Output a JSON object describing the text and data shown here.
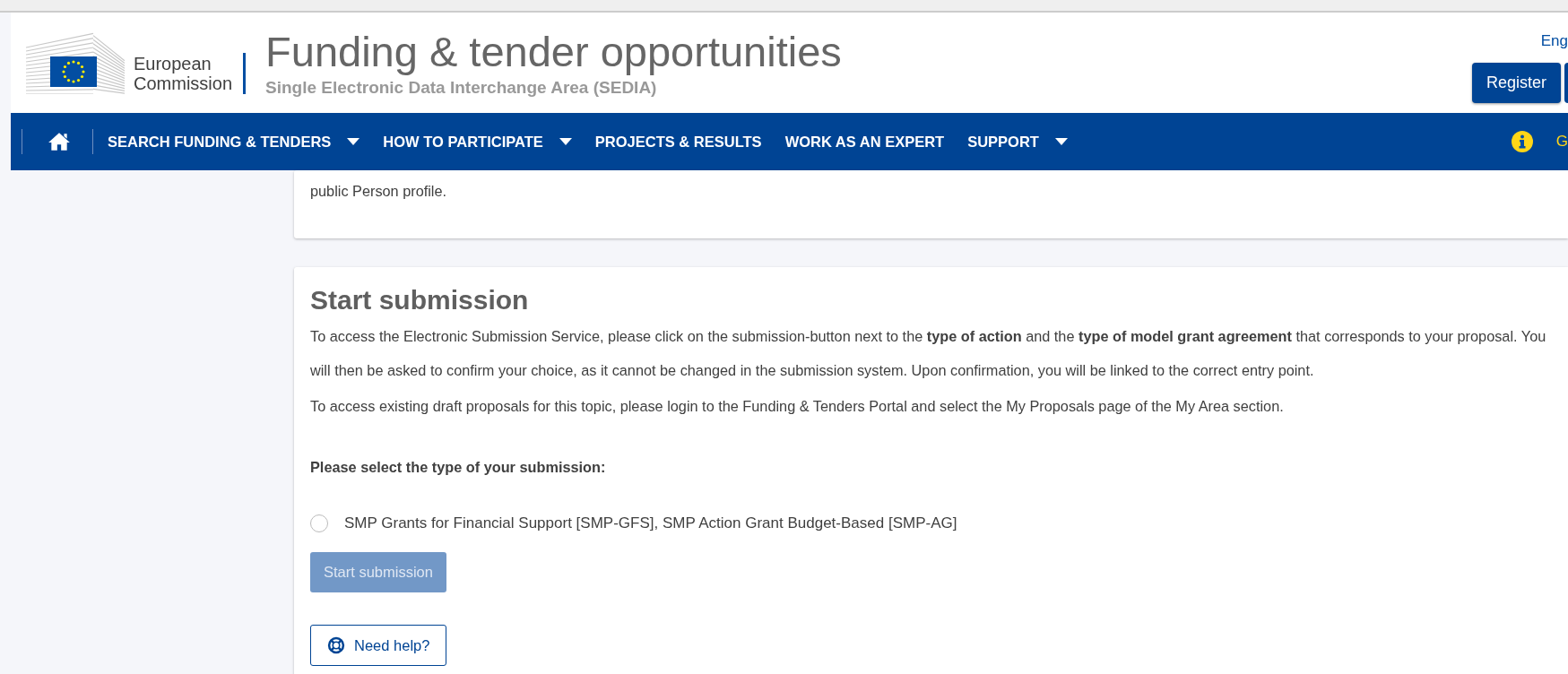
{
  "header": {
    "logo_text": [
      "European",
      "Commission"
    ],
    "title": "Funding & tender opportunities",
    "subtitle": "Single Electronic Data Interchange Area (SEDIA)",
    "language": "Eng",
    "register_button": "Register"
  },
  "nav": {
    "items": [
      {
        "label": "SEARCH FUNDING & TENDERS",
        "dropdown": true
      },
      {
        "label": "HOW TO PARTICIPATE",
        "dropdown": true
      },
      {
        "label": "PROJECTS & RESULTS",
        "dropdown": false
      },
      {
        "label": "WORK AS AN EXPERT",
        "dropdown": false
      },
      {
        "label": "SUPPORT",
        "dropdown": true
      }
    ],
    "right_text": "G"
  },
  "previous_card": {
    "text": "public Person profile."
  },
  "submission": {
    "heading": "Start submission",
    "paragraphs": [
      "To access the Electronic Submission Service, please click on the submission-button next to the **type of action** and the **type of model grant agreement** that corresponds to your proposal. You will then be asked to confirm your choice, as it cannot be changed in the submission system. Upon confirmation, you will be linked to the correct entry point.",
      "To access existing draft proposals for this topic, please login to the Funding & Tenders Portal and select the My Proposals page of the My Area section."
    ],
    "select_label": "Please select the type of your submission:",
    "options": [
      {
        "label": "SMP Grants for Financial Support [SMP-GFS], SMP Action Grant Budget-Based [SMP-AG]",
        "selected": false
      }
    ],
    "start_button": {
      "label": "Start submission",
      "disabled": true
    },
    "help_button": "Need help?"
  }
}
